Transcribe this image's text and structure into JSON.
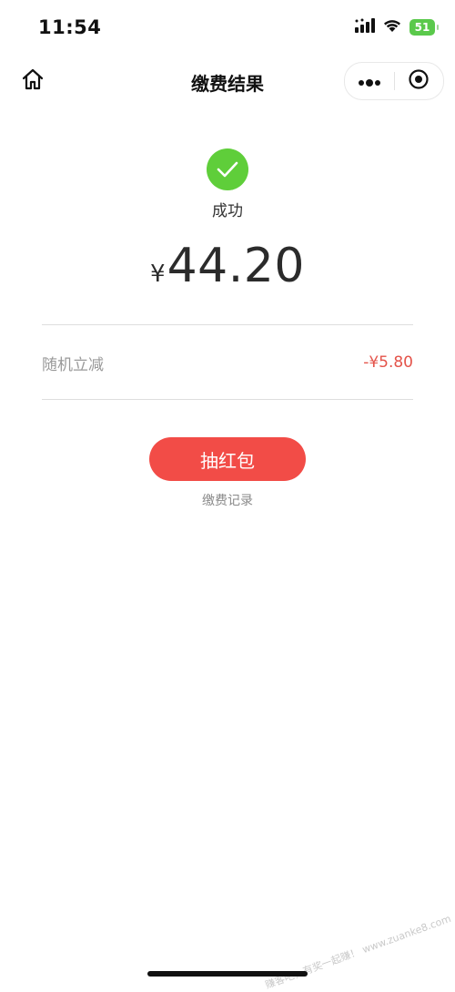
{
  "status_bar": {
    "time": "11:54",
    "battery": "51"
  },
  "nav": {
    "title": "缴费结果"
  },
  "result": {
    "status_text": "成功",
    "currency_symbol": "¥",
    "amount": "44.20"
  },
  "discount": {
    "label": "随机立减",
    "value": "-¥5.80"
  },
  "actions": {
    "red_packet_label": "抽红包",
    "record_link": "缴费记录"
  },
  "watermark": "赚客吧，有奖一起赚！ www.zuanke8.com",
  "colors": {
    "success_green": "#5fce3a",
    "accent_red": "#f24c47",
    "discount_red": "#e4534a"
  }
}
